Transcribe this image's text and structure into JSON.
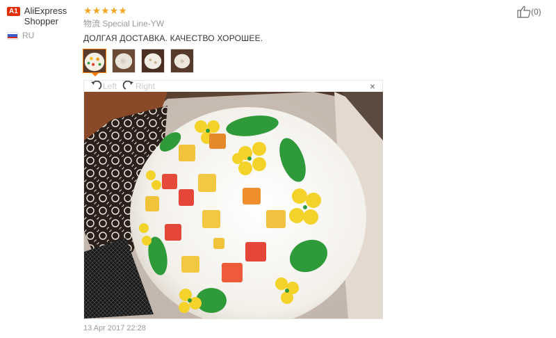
{
  "user": {
    "badge": "A1",
    "name": "AliExpress Shopper",
    "country": "RU"
  },
  "rating": {
    "stars": 5,
    "color": "#f5a623"
  },
  "shipping": "物流 Special Line-YW",
  "review_text": "ДОЛГАЯ ДОСТАВКА. КАЧЕСТВО ХОРОШЕЕ.",
  "thumbnails": [
    {
      "icon": "cake-photo-thumbnail",
      "active": true
    },
    {
      "icon": "cake-photo-thumbnail",
      "active": false
    },
    {
      "icon": "cake-photo-thumbnail",
      "active": false
    },
    {
      "icon": "cake-photo-thumbnail",
      "active": false
    }
  ],
  "viewer": {
    "rotate_left_label": "Left",
    "rotate_right_label": "Right",
    "close_glyph": "×"
  },
  "date": "13 Apr 2017 22:28",
  "helpful": {
    "count_text": "(0)",
    "icon": "thumbs-up-icon"
  },
  "colors": {
    "accent": "#f57b00",
    "badge": "#e62e04"
  }
}
